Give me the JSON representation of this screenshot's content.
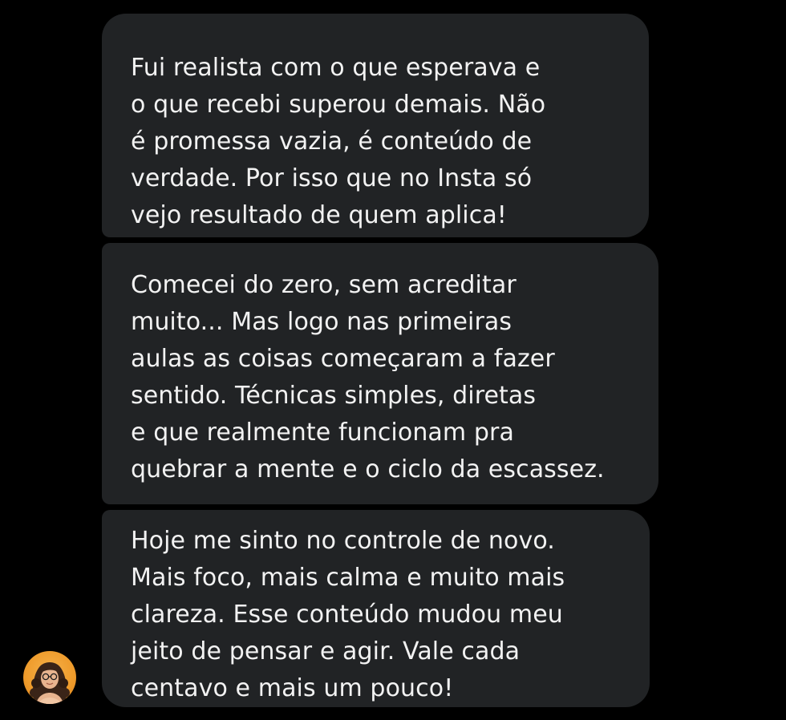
{
  "messages": [
    {
      "lines": [
        "Fui realista com o que esperava e",
        "o que recebi superou demais. Não",
        "é promessa vazia, é conteúdo de",
        "verdade. Por isso que no Insta só",
        "vejo resultado de quem aplica!"
      ]
    },
    {
      "lines": [
        "Comecei do zero, sem acreditar",
        "muito... Mas logo nas primeiras",
        "aulas as coisas começaram a fazer",
        "sentido. Técnicas simples, diretas",
        "e que realmente funcionam pra",
        "quebrar a mente e o ciclo da escassez."
      ]
    },
    {
      "lines": [
        "Hoje me sinto no controle de novo.",
        "Mais foco, mais calma e muito mais",
        "clareza. Esse conteúdo mudou meu",
        "jeito de pensar e agir. Vale cada",
        "centavo e mais um pouco!"
      ]
    }
  ],
  "colors": {
    "background": "#000000",
    "bubble": "#212325",
    "text": "#f2f2f2",
    "avatar_background": "#ee9a2a"
  },
  "icons": {
    "avatar": "sender-avatar-photo"
  }
}
